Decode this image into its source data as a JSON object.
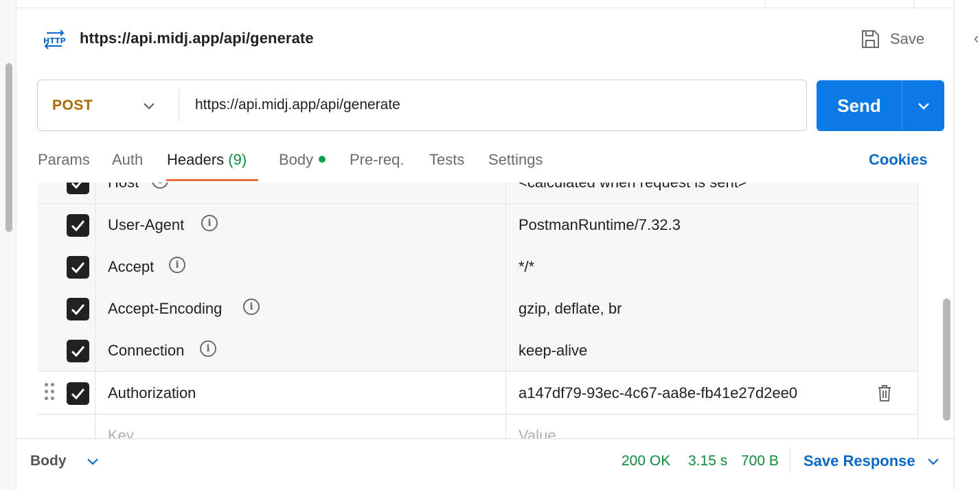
{
  "request": {
    "title": "https://api.midj.app/api/generate",
    "icon": "http-icon",
    "save_label": "Save",
    "method": "POST",
    "url": "https://api.midj.app/api/generate",
    "send_label": "Send"
  },
  "tabs": [
    {
      "label": "Params"
    },
    {
      "label": "Auth"
    },
    {
      "label": "Headers",
      "count": "(9)",
      "active": true
    },
    {
      "label": "Body",
      "has_content_dot": true
    },
    {
      "label": "Pre-req."
    },
    {
      "label": "Tests"
    },
    {
      "label": "Settings"
    }
  ],
  "cookies_label": "Cookies",
  "headers": [
    {
      "key": "Host",
      "value": "<calculated when request is sent>",
      "checked": true,
      "info": true,
      "partially_visible": true
    },
    {
      "key": "User-Agent",
      "value": "PostmanRuntime/7.32.3",
      "checked": true,
      "info": true
    },
    {
      "key": "Accept",
      "value": "*/*",
      "checked": true,
      "info": true
    },
    {
      "key": "Accept-Encoding",
      "value": "gzip, deflate, br",
      "checked": true,
      "info": true
    },
    {
      "key": "Connection",
      "value": "keep-alive",
      "checked": true,
      "info": true
    },
    {
      "key": "Authorization",
      "value": "a147df79-93ec-4c67-aa8e-fb41e27d2ee0",
      "checked": true,
      "info": false,
      "editable": true
    }
  ],
  "new_row": {
    "key_placeholder": "Key",
    "value_placeholder": "Value"
  },
  "response": {
    "body_label": "Body",
    "status": "200 OK",
    "time": "3.15 s",
    "size": "700 B",
    "save_response_label": "Save Response"
  },
  "colors": {
    "method": "#a66a00",
    "send": "#0c7ae6",
    "tab_underline": "#f26b3a",
    "status_green": "#0f8a3a",
    "link_blue": "#0b68c6"
  }
}
